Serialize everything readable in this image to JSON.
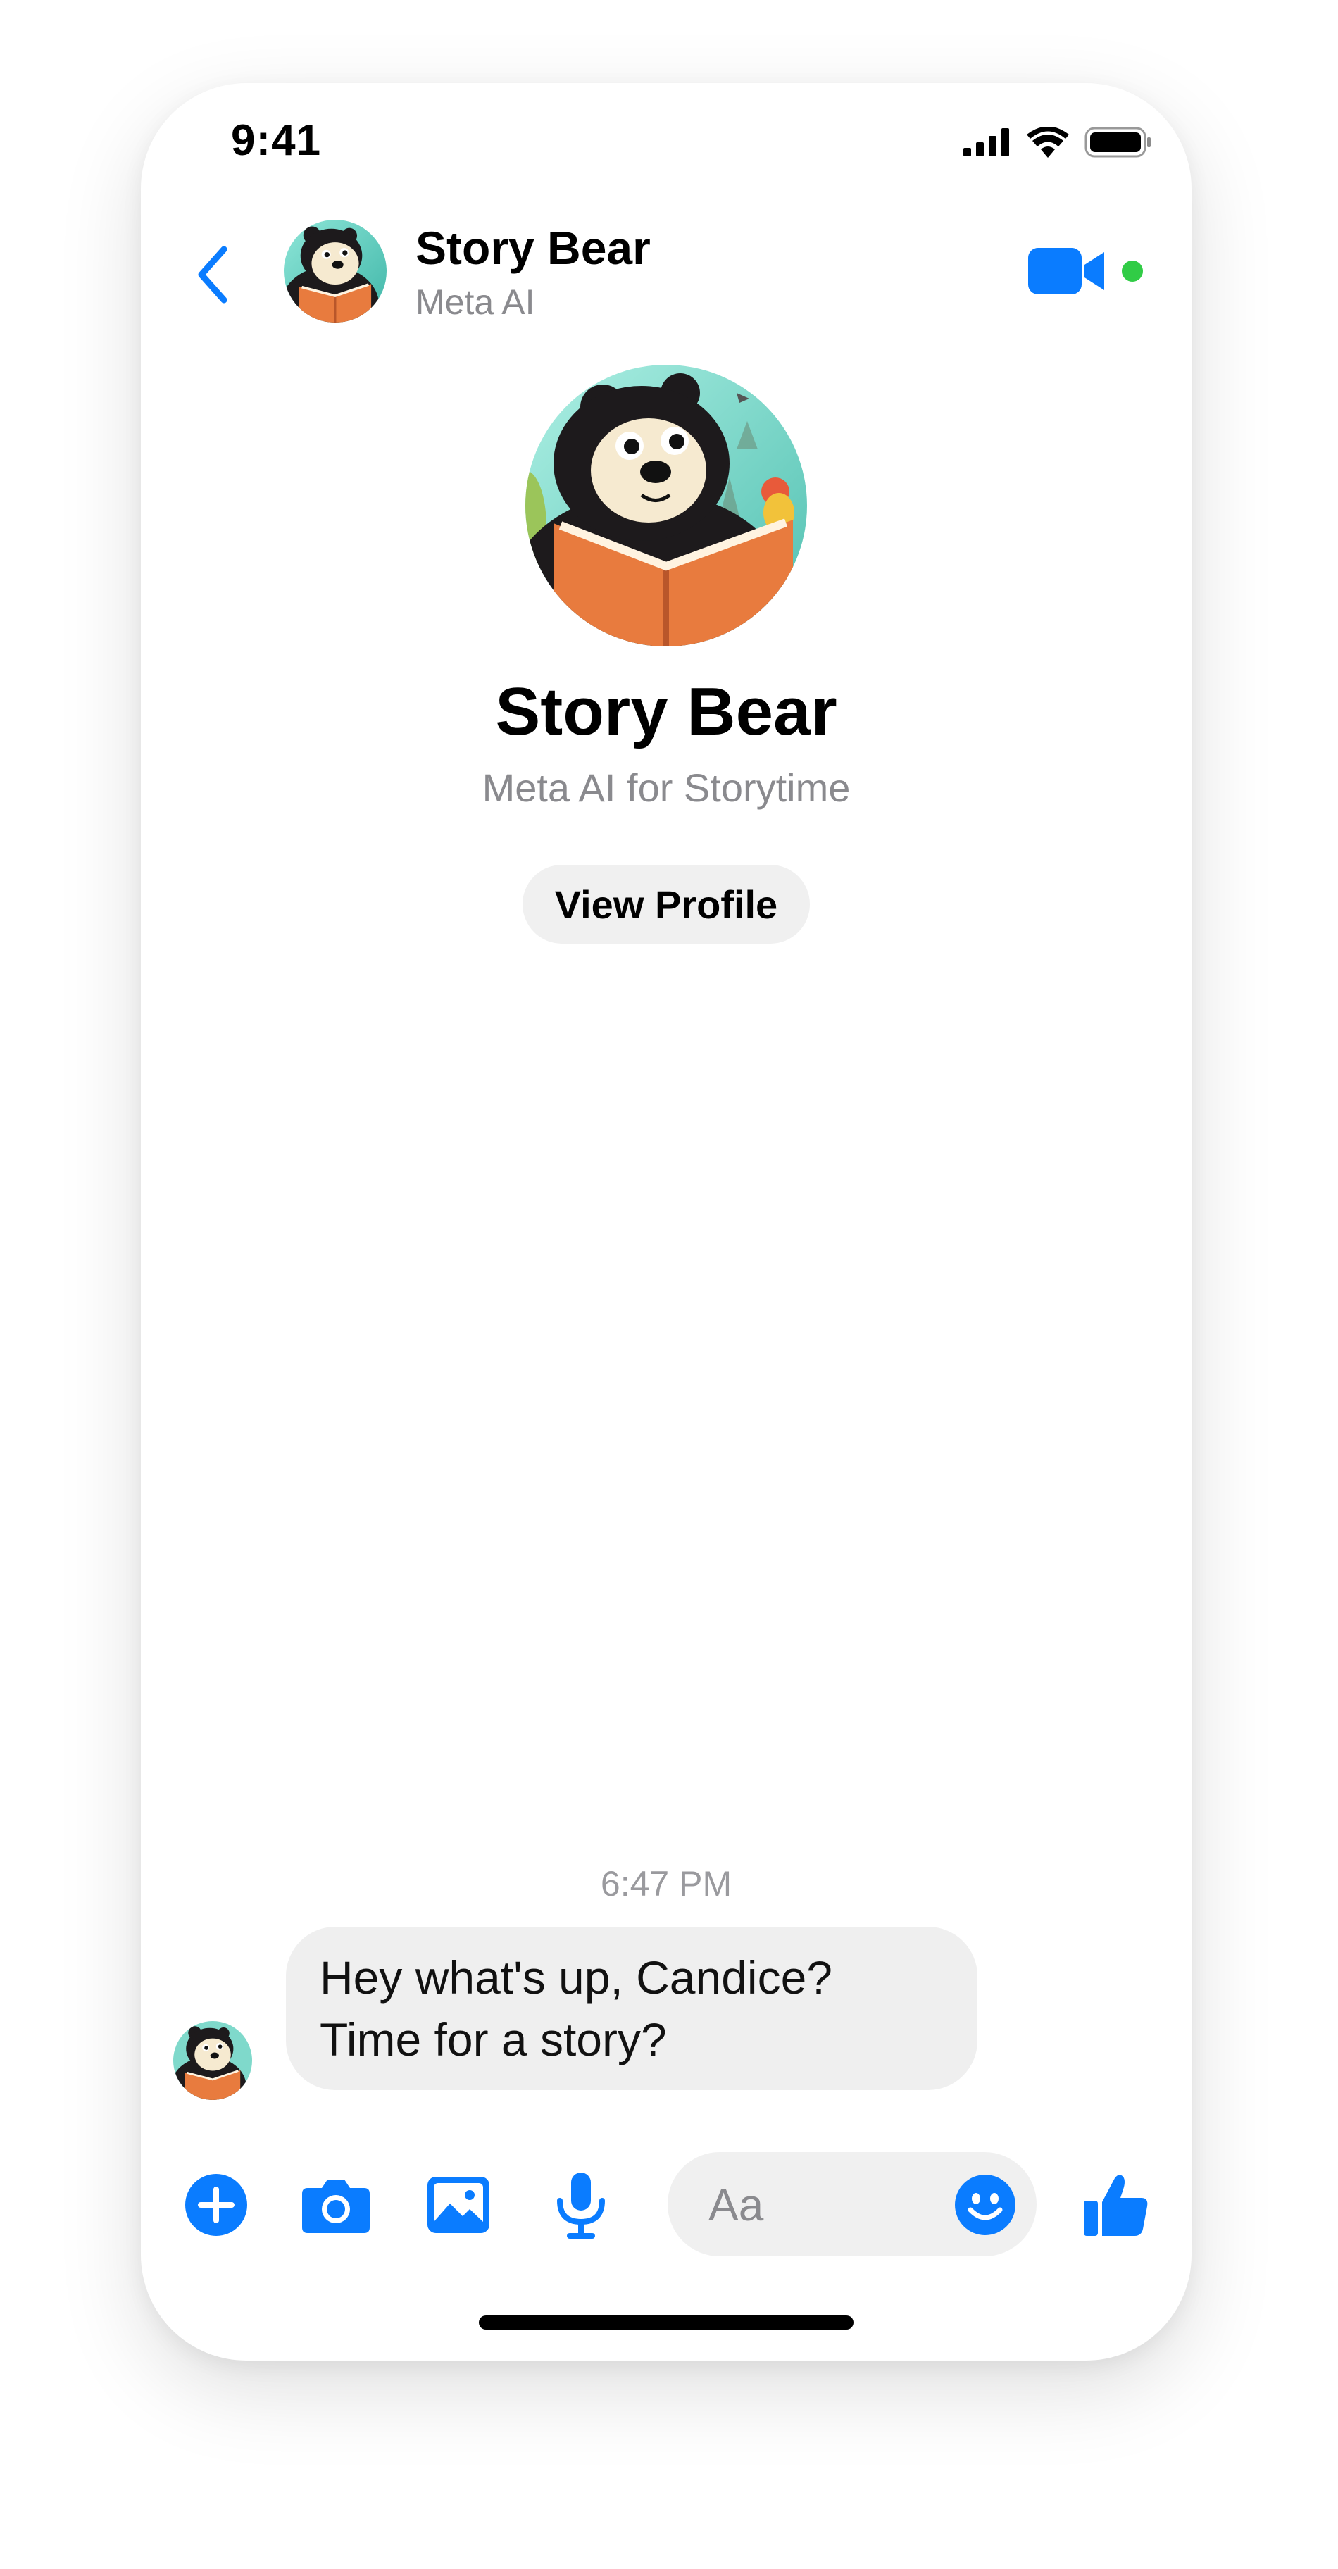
{
  "status_bar": {
    "time": "9:41",
    "signal_icon": "cellular-signal-icon",
    "wifi_icon": "wifi-icon",
    "battery_icon": "battery-icon"
  },
  "header": {
    "back_icon": "chevron-left-icon",
    "name": "Story Bear",
    "subtitle": "Meta AI",
    "video_icon": "video-camera-icon",
    "online": true
  },
  "profile": {
    "name": "Story Bear",
    "description": "Meta AI for Storytime",
    "view_profile_label": "View Profile"
  },
  "conversation": {
    "timestamp": "6:47 PM",
    "messages": [
      {
        "sender": "Story Bear",
        "lines": [
          "Hey what's up, Candice?",
          "Time for a story?"
        ]
      }
    ]
  },
  "composer": {
    "placeholder": "Aa",
    "icons": [
      "plus-icon",
      "camera-icon",
      "image-icon",
      "microphone-icon",
      "emoji-icon",
      "thumbs-up-icon"
    ]
  },
  "colors": {
    "accent": "#0A7CFF",
    "online": "#31CC46",
    "bubble": "#EFEFEF",
    "secondary_text": "#8A8A8E"
  }
}
